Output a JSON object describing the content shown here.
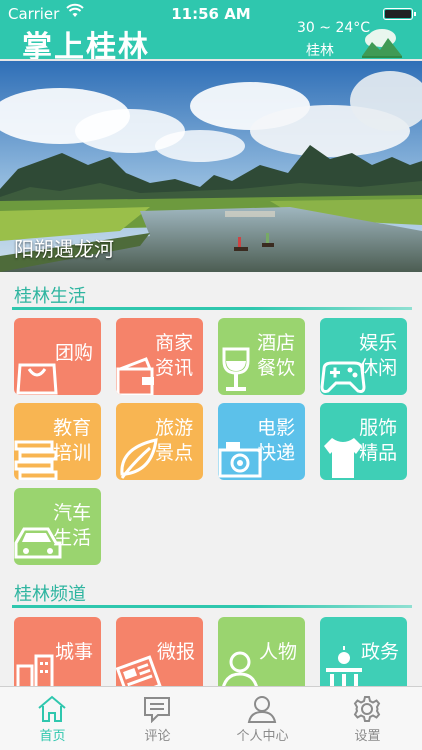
{
  "status_bar": {
    "carrier": "Carrier",
    "time": "11:56 AM"
  },
  "header": {
    "title": "掌上桂林",
    "temperature": "30 ~ 24°C",
    "city": "桂林",
    "weather_icon": "cloudy-mountain-icon"
  },
  "banner": {
    "caption": "阳朔遇龙河"
  },
  "life_section": {
    "title": "桂林生活",
    "tiles": [
      {
        "label": "团购",
        "icon": "shopping-bag-icon"
      },
      {
        "label_line1": "商家",
        "label_line2": "资讯",
        "icon": "wallet-icon"
      },
      {
        "label_line1": "酒店",
        "label_line2": "餐饮",
        "icon": "wine-glass-icon"
      },
      {
        "label_line1": "娱乐",
        "label_line2": "休闲",
        "icon": "gamepad-icon"
      },
      {
        "label_line1": "教育",
        "label_line2": "培训",
        "icon": "books-icon"
      },
      {
        "label_line1": "旅游",
        "label_line2": "景点",
        "icon": "leaf-icon"
      },
      {
        "label_line1": "电影",
        "label_line2": "快递",
        "icon": "camera-icon"
      },
      {
        "label_line1": "服饰",
        "label_line2": "精品",
        "icon": "tshirt-icon"
      },
      {
        "label_line1": "汽车",
        "label_line2": "生活",
        "icon": "car-icon"
      }
    ]
  },
  "channel_section": {
    "title": "桂林频道",
    "tiles": [
      {
        "label": "城事",
        "icon": "city-buildings-icon"
      },
      {
        "label": "微报",
        "icon": "newspaper-icon"
      },
      {
        "label": "人物",
        "icon": "person-icon"
      },
      {
        "label": "政务",
        "icon": "government-icon"
      }
    ]
  },
  "tab_bar": {
    "tabs": [
      {
        "label": "首页",
        "icon": "home-icon",
        "active": true
      },
      {
        "label": "评论",
        "icon": "comment-icon",
        "active": false
      },
      {
        "label": "个人中心",
        "icon": "user-icon",
        "active": false
      },
      {
        "label": "设置",
        "icon": "gear-icon",
        "active": false
      }
    ]
  },
  "colors": {
    "brand": "#2fc7ae",
    "salmon": "#f5836a",
    "green": "#9ad46f",
    "teal": "#3fcfb6",
    "orange": "#f8b552",
    "blue": "#5cc1ea"
  }
}
